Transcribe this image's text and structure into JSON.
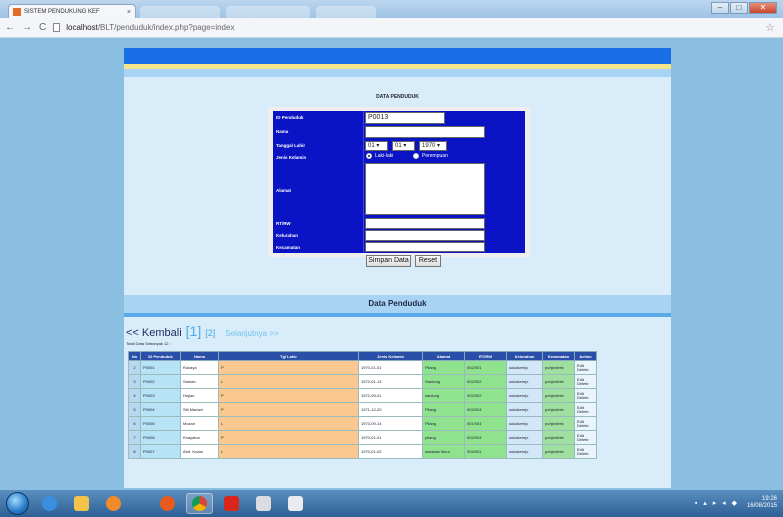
{
  "browser": {
    "tab_title": "SISTEM PENDUKUNG KEF",
    "tab_close": "×",
    "url_host": "localhost",
    "url_path": "/BLT/penduduk/index.php?page=index"
  },
  "page": {
    "form_section_title": "DATA PENDUDUK",
    "form": {
      "labels": {
        "id": "ID Penduduk",
        "nama": "Nama",
        "tgl_lahir": "Tanggal Lahir",
        "jk": "Jenis Kelamin",
        "alamat": "Alamat",
        "rtrw": "RT/RW",
        "kelurahan": "Kelurahan",
        "kecamatan": "Kecamatan"
      },
      "id_value": "P0013",
      "nama_value": "",
      "tgl_day": "01",
      "tgl_month": "01",
      "tgl_year": "1970",
      "jk_male": "Laki-laki",
      "jk_female": "Perempuan",
      "jk_selected": "Laki-laki",
      "alamat_value": "",
      "rtrw_value": "",
      "kelurahan_value": "",
      "kecamatan_value": "",
      "save_label": "Simpan Data",
      "reset_label": "Reset"
    },
    "list_title": "Data Penduduk",
    "pager": {
      "back": "<< Kembali",
      "page1": "[1]",
      "page2": "[2]",
      "next": "Selanjutnya >>"
    },
    "total_text": "Total Data Sebanyak 12 :",
    "table": {
      "headers": [
        "No",
        "ID Penduduk",
        "Nama",
        "Tgl Lahir",
        "Jenis Kelamin",
        "Alamat",
        "RT/RW",
        "Kelurahan",
        "Kecamatan",
        "Action"
      ],
      "rows": [
        {
          "no": "2",
          "id": "P0001",
          "nama": "Rukaya",
          "jk": "P",
          "tgl": "1970-01-01",
          "alamat": "Pilang",
          "rtrw": "002/001",
          "kel": "sukakerejo",
          "kec": "pohjentrek"
        },
        {
          "no": "3",
          "id": "P0002",
          "nama": "Santan",
          "jk": "L",
          "tgl": "1972-01-13",
          "alamat": "Santong",
          "rtrw": "002/002",
          "kel": "sukakerejo",
          "kec": "pohjentrek"
        },
        {
          "no": "4",
          "id": "P0003",
          "nama": "Hujlan",
          "jk": "P",
          "tgl": "1972-09-01",
          "alamat": "santong",
          "rtrw": "002/002",
          "kel": "sukakerejo",
          "kec": "pohjentrek"
        },
        {
          "no": "5",
          "id": "P0004",
          "nama": "Siti Mariani",
          "jk": "P",
          "tgl": "1971-12-20",
          "alamat": "Pilang",
          "rtrw": "002/004",
          "kel": "sukakerejo",
          "kec": "pohjentrek"
        },
        {
          "no": "6",
          "id": "P0005",
          "nama": "Mozan",
          "jk": "L",
          "tgl": "1973-09-14",
          "alamat": "Pilang",
          "rtrw": "001/004",
          "kel": "sukakerejo",
          "kec": "pohjentrek"
        },
        {
          "no": "7",
          "id": "P0006",
          "nama": "Khayatun",
          "jk": "P",
          "tgl": "1970-01-01",
          "alamat": "pilang",
          "rtrw": "002/004",
          "kel": "sukakerejo",
          "kec": "pohjentrek"
        },
        {
          "no": "8",
          "id": "P0007",
          "nama": "Abd. Kodar",
          "jk": "L",
          "tgl": "1970-01-02",
          "alamat": "sukakan timur",
          "rtrw": "004/001",
          "kel": "sukakerejo",
          "kec": "pohjentrek"
        }
      ],
      "action_edit": "Edit",
      "action_delete": "Delete"
    }
  },
  "taskbar": {
    "time": "19:26",
    "date": "16/08/2015"
  },
  "colors": {
    "form_bg": "#0a14c4",
    "banner": "#1a6fe8",
    "banner_stripe": "#f4e58a",
    "page_bg": "#8bbfe2"
  }
}
